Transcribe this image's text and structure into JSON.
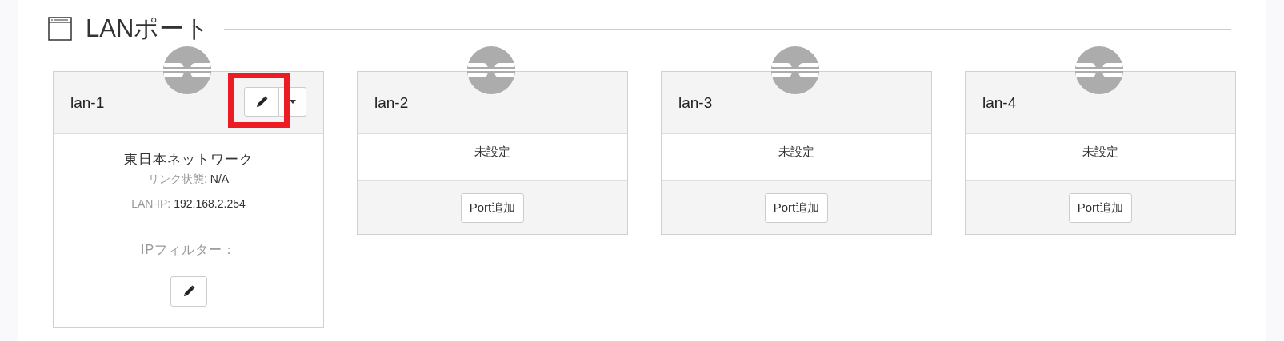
{
  "section": {
    "title": "LANポート"
  },
  "ports": [
    {
      "kind": "configured",
      "name": "lan-1",
      "actions": {
        "highlighted": true
      },
      "network": "東日本ネットワーク",
      "link_state": {
        "label": "リンク状態:",
        "value": "N/A"
      },
      "lan_ip": {
        "label": "LAN-IP:",
        "value": "192.168.2.254"
      },
      "ip_filter_label": "IPフィルター："
    },
    {
      "kind": "unset",
      "name": "lan-2",
      "status": "未設定",
      "add_button": "Port追加"
    },
    {
      "kind": "unset",
      "name": "lan-3",
      "status": "未設定",
      "add_button": "Port追加"
    },
    {
      "kind": "unset",
      "name": "lan-4",
      "status": "未設定",
      "add_button": "Port追加"
    }
  ]
}
